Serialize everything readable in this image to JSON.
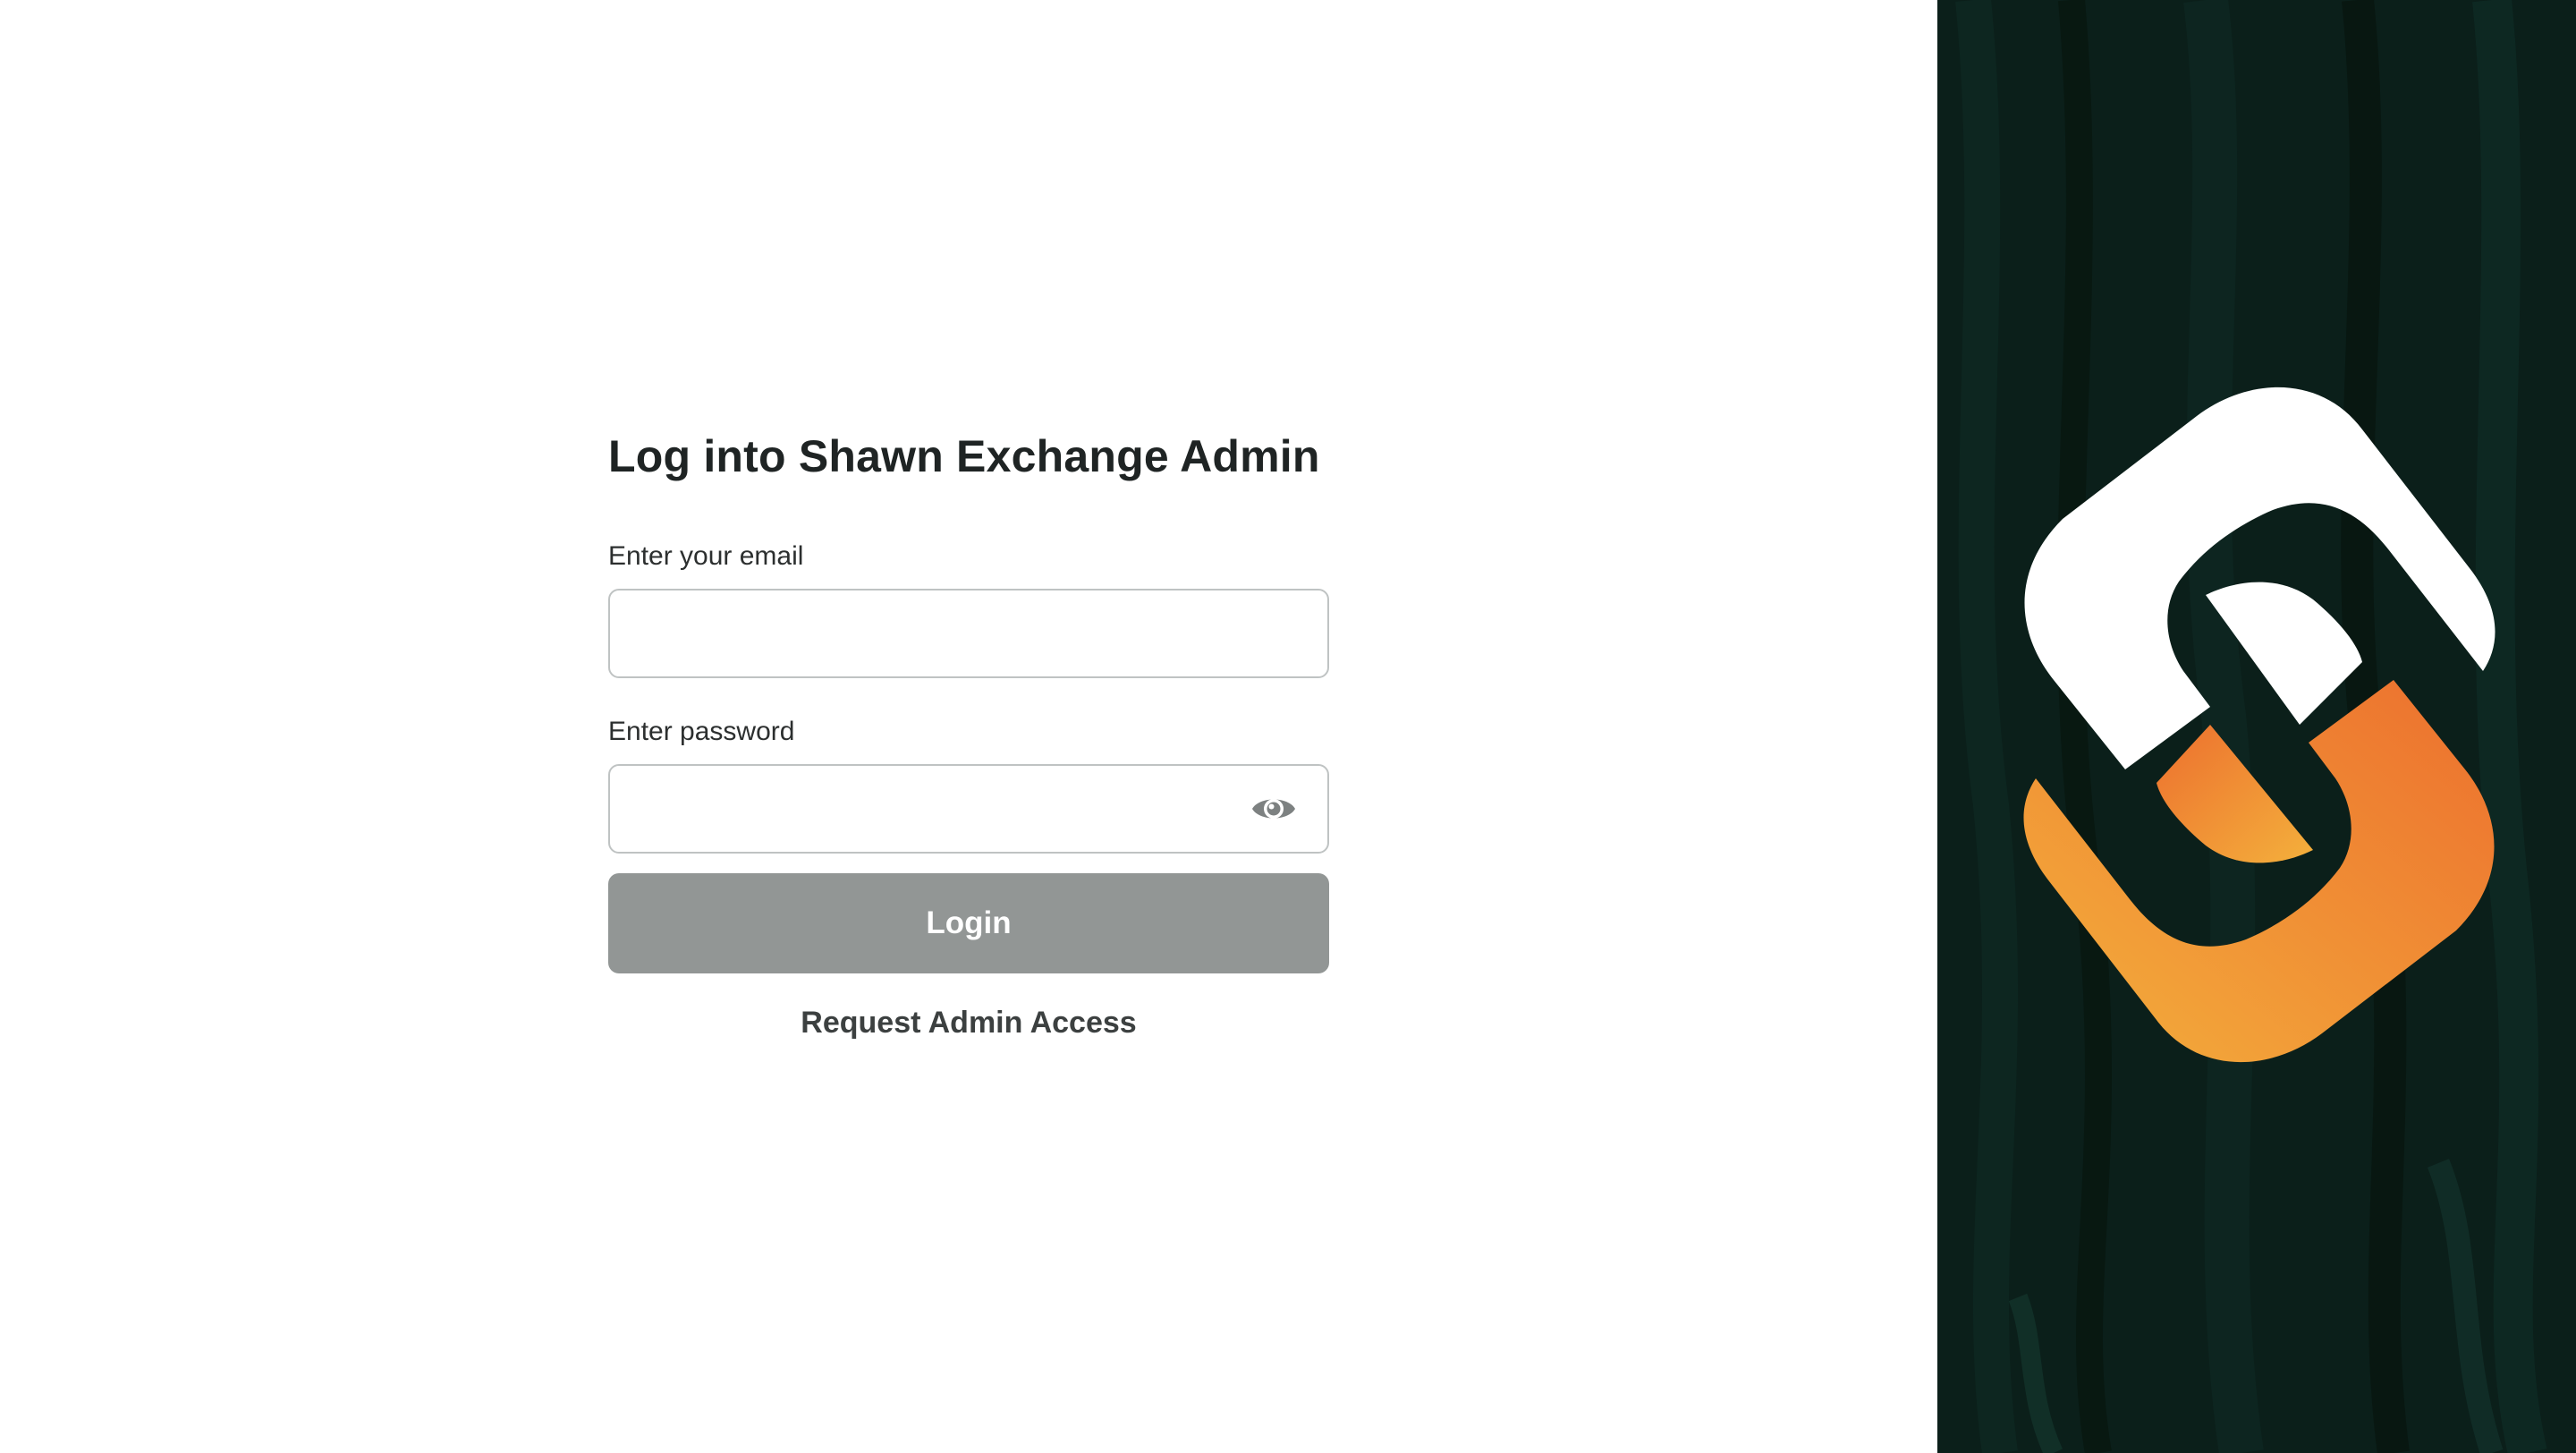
{
  "login": {
    "title": "Log into Shawn Exchange Admin",
    "email_label": "Enter your email",
    "email_value": "",
    "password_label": "Enter password",
    "password_value": "",
    "show_password_icon": "eye-icon",
    "login_button": "Login",
    "request_access_link": "Request Admin Access"
  },
  "brand": {
    "logo": "shawn-exchange-logo",
    "background_color": "#0b1f1a",
    "logo_white": "#ffffff",
    "logo_orange_start": "#f4b03c",
    "logo_orange_end": "#ec6f2e"
  },
  "colors": {
    "title": "#1f2424",
    "button_disabled": "#929695",
    "input_border": "#bfc3c3"
  }
}
